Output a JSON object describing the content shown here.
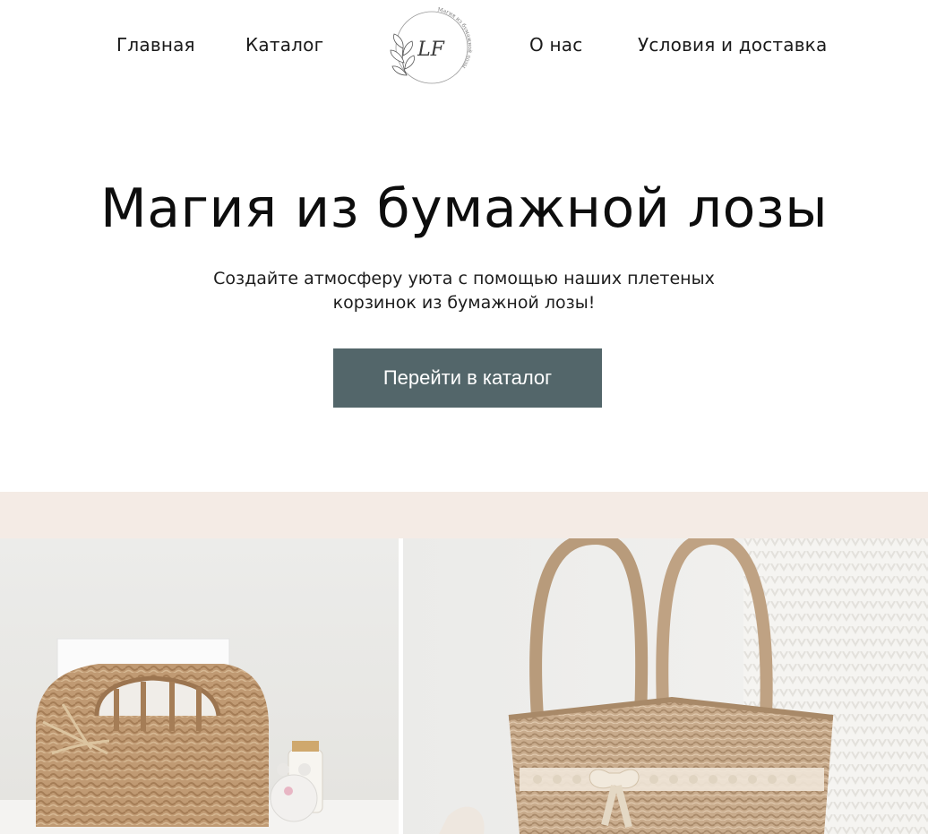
{
  "nav": {
    "items": [
      {
        "label": "Главная"
      },
      {
        "label": "Каталог"
      },
      {
        "label": "О нас"
      },
      {
        "label": "Условия и доставка"
      }
    ],
    "logo": {
      "monogram": "LF",
      "ring_text": "Магия из бумажной лозы",
      "icon": "ginkgo-leaf-icon"
    }
  },
  "hero": {
    "title": "Магия из бумажной лозы",
    "subtitle_line1": "Создайте атмосферу уюта с помощью наших плетеных",
    "subtitle_line2": "корзинок из бумажной лозы!",
    "cta_label": "Перейти в каталог"
  },
  "colors": {
    "cta_background": "#53666a",
    "band": "#f4ebe5",
    "wicker": "#c4a27e"
  },
  "gallery": [
    {
      "name": "napkin-holder-basket-photo"
    },
    {
      "name": "handle-basket-photo"
    }
  ]
}
